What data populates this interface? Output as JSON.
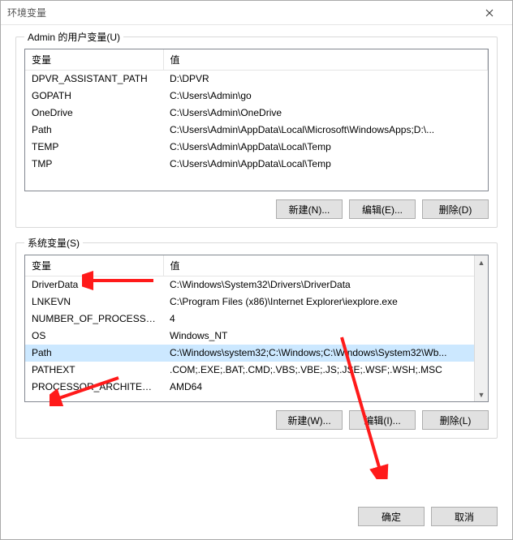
{
  "window": {
    "title": "环境变量"
  },
  "user_section": {
    "legend": "Admin 的用户变量(U)",
    "col_var": "变量",
    "col_val": "值",
    "rows": [
      {
        "var": "DPVR_ASSISTANT_PATH",
        "val": "D:\\DPVR"
      },
      {
        "var": "GOPATH",
        "val": "C:\\Users\\Admin\\go"
      },
      {
        "var": "OneDrive",
        "val": "C:\\Users\\Admin\\OneDrive"
      },
      {
        "var": "Path",
        "val": "C:\\Users\\Admin\\AppData\\Local\\Microsoft\\WindowsApps;D:\\..."
      },
      {
        "var": "TEMP",
        "val": "C:\\Users\\Admin\\AppData\\Local\\Temp"
      },
      {
        "var": "TMP",
        "val": "C:\\Users\\Admin\\AppData\\Local\\Temp"
      }
    ],
    "btn_new": "新建(N)...",
    "btn_edit": "编辑(E)...",
    "btn_delete": "删除(D)"
  },
  "system_section": {
    "legend": "系统变量(S)",
    "col_var": "变量",
    "col_val": "值",
    "rows": [
      {
        "var": "DriverData",
        "val": "C:\\Windows\\System32\\Drivers\\DriverData"
      },
      {
        "var": "LNKEVN",
        "val": "C:\\Program Files (x86)\\Internet Explorer\\iexplore.exe"
      },
      {
        "var": "NUMBER_OF_PROCESSORS",
        "val": "4"
      },
      {
        "var": "OS",
        "val": "Windows_NT"
      },
      {
        "var": "Path",
        "val": "C:\\Windows\\system32;C:\\Windows;C:\\Windows\\System32\\Wb..."
      },
      {
        "var": "PATHEXT",
        "val": ".COM;.EXE;.BAT;.CMD;.VBS;.VBE;.JS;.JSE;.WSF;.WSH;.MSC"
      },
      {
        "var": "PROCESSOR_ARCHITECT...",
        "val": "AMD64"
      }
    ],
    "selected_index": 4,
    "btn_new": "新建(W)...",
    "btn_edit": "编辑(I)...",
    "btn_delete": "删除(L)"
  },
  "dialog": {
    "ok": "确定",
    "cancel": "取消"
  }
}
